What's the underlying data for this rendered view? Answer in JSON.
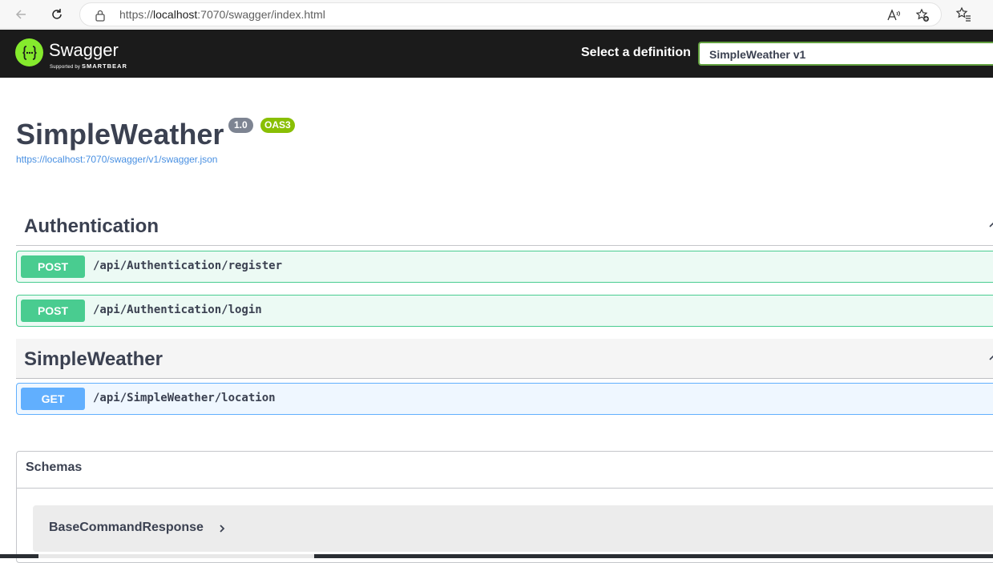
{
  "browser": {
    "url_prefix": "https://",
    "url_host": "localhost",
    "url_rest": ":7070/swagger/index.html"
  },
  "topbar": {
    "logo_title": "Swagger",
    "logo_sub_prefix": "Supported by",
    "logo_sub_brand": "SMARTBEAR",
    "definition_label": "Select a definition",
    "definition_value": "SimpleWeather v1"
  },
  "info": {
    "title": "SimpleWeather",
    "version": "1.0",
    "oas": "OAS3",
    "spec_url": "https://localhost:7070/swagger/v1/swagger.json"
  },
  "tags": [
    {
      "name": "Authentication",
      "operations": [
        {
          "method": "POST",
          "path": "/api/Authentication/register"
        },
        {
          "method": "POST",
          "path": "/api/Authentication/login"
        }
      ]
    },
    {
      "name": "SimpleWeather",
      "operations": [
        {
          "method": "GET",
          "path": "/api/SimpleWeather/location"
        }
      ]
    }
  ],
  "schemas": {
    "title": "Schemas",
    "models": [
      "BaseCommandResponse"
    ]
  },
  "colors": {
    "post": "#49cc90",
    "get": "#61affe",
    "topbar": "#1b1b1b",
    "logo": "#85ea2d"
  }
}
